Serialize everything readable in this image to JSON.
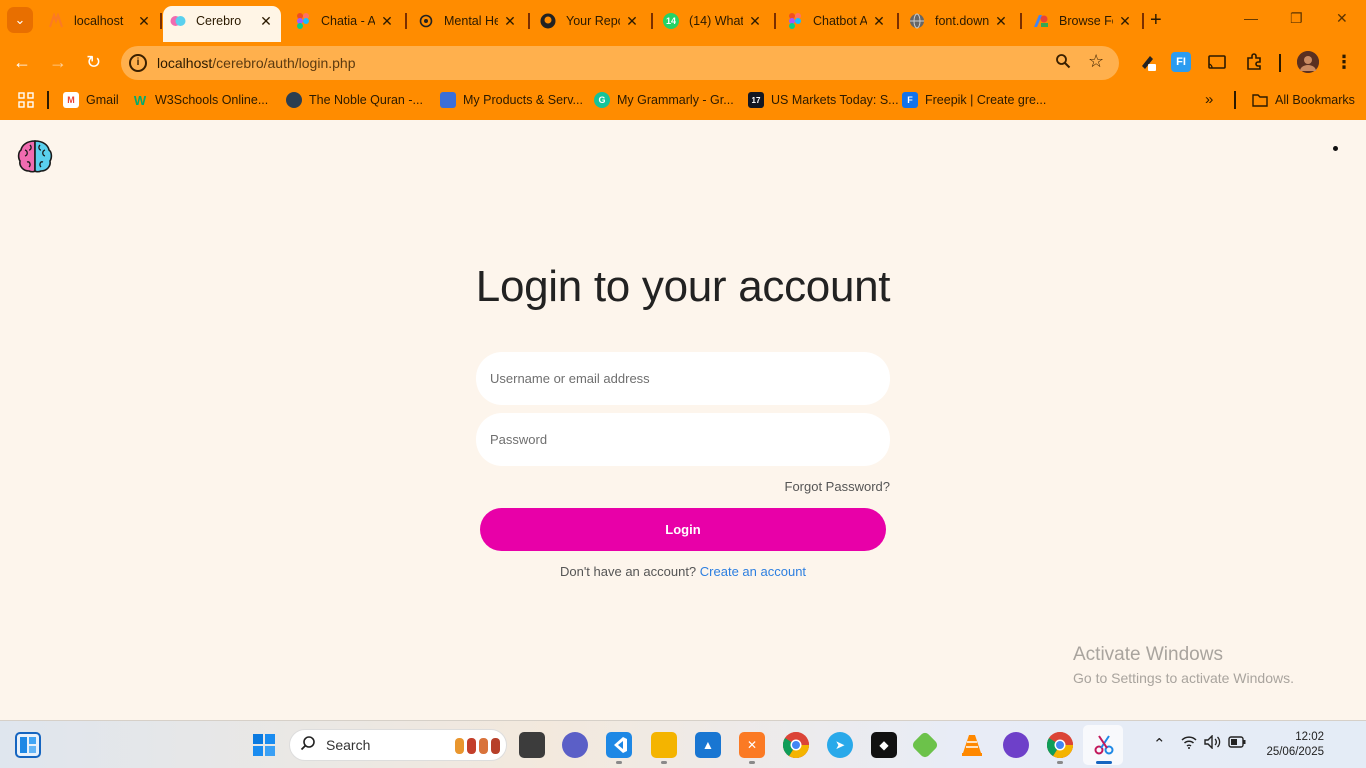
{
  "browser": {
    "tabs": [
      {
        "title": "localhost",
        "favicon": "xampp-icon",
        "color": "#fb7a24"
      },
      {
        "title": "Cerebro",
        "favicon": "brain-icon",
        "color": "#e8439a",
        "active": true
      },
      {
        "title": "Chatia - A",
        "favicon": "figma-icon",
        "color": "#f24e1e"
      },
      {
        "title": "Mental He",
        "favicon": "openai-icon",
        "color": "#222222"
      },
      {
        "title": "Your Repo",
        "favicon": "github-icon",
        "color": "#222222"
      },
      {
        "title": "(14) What",
        "favicon": "whatsapp-icon",
        "color": "#25d366",
        "badge": "14"
      },
      {
        "title": "Chatbot A",
        "favicon": "figma-icon",
        "color": "#f24e1e"
      },
      {
        "title": "font.down",
        "favicon": "globe-icon",
        "color": "#555555"
      },
      {
        "title": "Browse Fo",
        "favicon": "google-fonts-icon",
        "color": "#4285f4"
      }
    ],
    "url_host": "localhost",
    "url_path": "/cerebro/auth/login.php",
    "bookmarks": [
      {
        "label": "Gmail",
        "icon": "gmail-icon",
        "color": "#ea4335",
        "glyph": "M"
      },
      {
        "label": "W3Schools Online...",
        "icon": "w3schools-icon",
        "color": "#04aa6d",
        "glyph": "W"
      },
      {
        "label": "The Noble Quran -...",
        "icon": "quran-icon",
        "color": "#2c3e50",
        "glyph": "Q"
      },
      {
        "label": "My Products & Serv...",
        "icon": "products-icon",
        "color": "#3b6fd8",
        "glyph": "P"
      },
      {
        "label": "My Grammarly - Gr...",
        "icon": "grammarly-icon",
        "color": "#15c39a",
        "glyph": "G"
      },
      {
        "label": "US Markets Today: S...",
        "icon": "tradingview-icon",
        "color": "#131722",
        "glyph": "17"
      },
      {
        "label": "Freepik | Create gre...",
        "icon": "freepik-icon",
        "color": "#1273eb",
        "glyph": "F"
      }
    ],
    "all_bookmarks": "All Bookmarks"
  },
  "page": {
    "title": "Login to your account",
    "username_placeholder": "Username or email address",
    "password_placeholder": "Password",
    "forgot": "Forgot Password?",
    "login_label": "Login",
    "signup_prompt": "Don't have an account?",
    "signup_link": "Create an account"
  },
  "watermark": {
    "line1": "Activate Windows",
    "line2": "Go to Settings to activate Windows."
  },
  "taskbar": {
    "search_label": "Search",
    "time": "12:02",
    "date": "25/06/2025"
  },
  "colors": {
    "chrome": "#ff8c00",
    "page_bg": "#fdf5ec",
    "accent": "#e800a8",
    "link": "#2d7fe0"
  }
}
